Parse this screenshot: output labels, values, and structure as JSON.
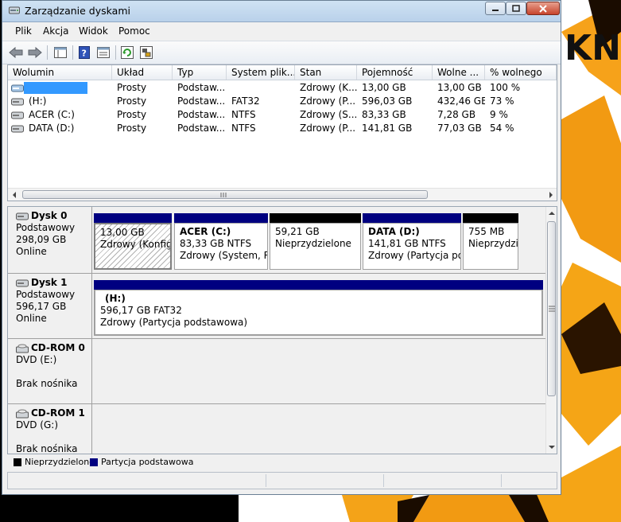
{
  "window": {
    "title": "Zarządzanie dyskami"
  },
  "menu": [
    "Plik",
    "Akcja",
    "Widok",
    "Pomoc"
  ],
  "toolbar": [
    "back-icon",
    "forward-icon",
    "properties-icon",
    "help-icon",
    "help-topics-icon",
    "refresh-icon",
    "settings-icon"
  ],
  "volume_list": {
    "columns": [
      "Wolumin",
      "Układ",
      "Typ",
      "System plik...",
      "Stan",
      "Pojemność",
      "Wolne ...",
      "% wolnego"
    ],
    "rows": [
      {
        "volume": "",
        "layout": "Prosty",
        "type": "Podstaw...",
        "fs": "",
        "status": "Zdrowy (K...",
        "capacity": "13,00 GB",
        "free": "13,00 GB",
        "pct": "100 %"
      },
      {
        "volume": "(H:)",
        "layout": "Prosty",
        "type": "Podstaw...",
        "fs": "FAT32",
        "status": "Zdrowy (P...",
        "capacity": "596,03 GB",
        "free": "432,46 GB",
        "pct": "73 %"
      },
      {
        "volume": "ACER (C:)",
        "layout": "Prosty",
        "type": "Podstaw...",
        "fs": "NTFS",
        "status": "Zdrowy (S...",
        "capacity": "83,33 GB",
        "free": "7,28 GB",
        "pct": "9 %"
      },
      {
        "volume": "DATA (D:)",
        "layout": "Prosty",
        "type": "Podstaw...",
        "fs": "NTFS",
        "status": "Zdrowy (P...",
        "capacity": "141,81 GB",
        "free": "77,03 GB",
        "pct": "54 %"
      }
    ]
  },
  "disks": [
    {
      "name": "Dysk 0",
      "kind": "Podstawowy",
      "size": "298,09 GB",
      "state": "Online",
      "partitions": [
        {
          "title": "",
          "line1": "13,00 GB",
          "line2": "Zdrowy (Konfigu"
        },
        {
          "title": "ACER  (C:)",
          "line1": "83,33 GB NTFS",
          "line2": "Zdrowy (System, Ro"
        },
        {
          "title": "",
          "line1": "59,21 GB",
          "line2": "Nieprzydzielone"
        },
        {
          "title": "DATA  (D:)",
          "line1": "141,81 GB NTFS",
          "line2": "Zdrowy (Partycja poc"
        },
        {
          "title": "",
          "line1": "755 MB",
          "line2": "Nieprzydzi"
        }
      ]
    },
    {
      "name": "Dysk 1",
      "kind": "Podstawowy",
      "size": "596,17 GB",
      "state": "Online",
      "partitions": [
        {
          "title": "(H:)",
          "line1": "596,17 GB FAT32",
          "line2": "Zdrowy (Partycja podstawowa)"
        }
      ]
    },
    {
      "name": "CD-ROM 0",
      "kind": "DVD (E:)",
      "size": "",
      "state": "Brak nośnika",
      "partitions": []
    },
    {
      "name": "CD-ROM 1",
      "kind": "DVD (G:)",
      "size": "",
      "state": "Brak nośnika",
      "partitions": []
    }
  ],
  "legend": [
    {
      "label": "Nieprzydzielone",
      "color": "#000000"
    },
    {
      "label": "Partycja podstawowa",
      "color": "#000080"
    }
  ],
  "colors": {
    "primary_partition": "#000080",
    "unallocated": "#000000",
    "selection": "#3399ff"
  }
}
